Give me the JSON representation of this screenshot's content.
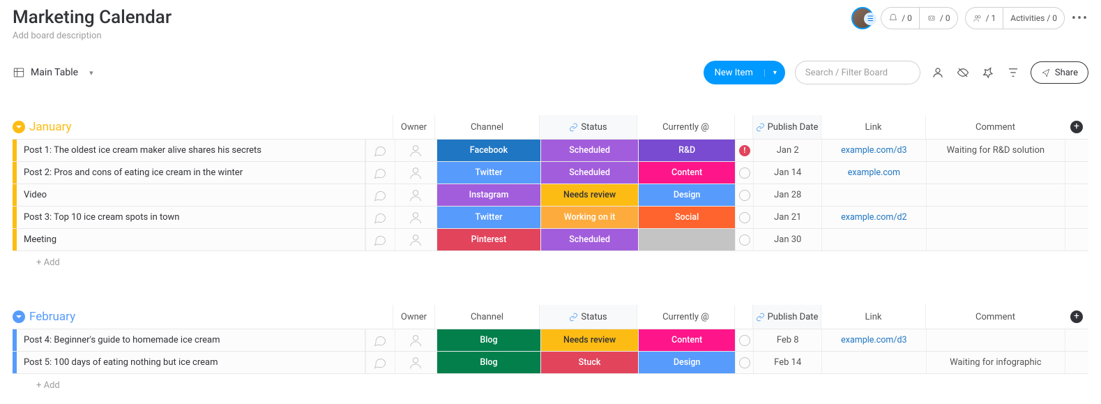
{
  "header": {
    "title": "Marketing Calendar",
    "description_placeholder": "Add board description",
    "counters": {
      "views": "/ 0",
      "integrations": "/ 0",
      "people": "/ 1",
      "activities": "Activities / 0"
    }
  },
  "toolbar": {
    "view_name": "Main Table",
    "new_item_label": "New Item",
    "search_placeholder": "Search / Filter Board",
    "share_label": "Share"
  },
  "columns": {
    "owner": "Owner",
    "channel": "Channel",
    "status": "Status",
    "currently": "Currently @",
    "publish": "Publish Date",
    "link": "Link",
    "comment": "Comment"
  },
  "colors": {
    "channel": {
      "Facebook": "#1f76c2",
      "Twitter": "#579bfc",
      "Instagram": "#a25ddc",
      "Pinterest": "#e2445c",
      "Blog": "#037f4c"
    },
    "status": {
      "Scheduled": "#a25ddc",
      "Needs review": "#fdbc13",
      "Working on it": "#fdab3d",
      "Stuck": "#e2445c"
    },
    "currently": {
      "R&D": "#784bd1",
      "Content": "#ff158a",
      "Design": "#579bfc",
      "Social": "#ff642e",
      "": "#c4c4c4"
    }
  },
  "groups": [
    {
      "name": "January",
      "color": "#fdbc13",
      "items": [
        {
          "name": "Post 1: The oldest ice cream maker alive shares his secrets",
          "channel": "Facebook",
          "status": "Scheduled",
          "currently": "R&D",
          "flag": "alert",
          "date": "Jan 2",
          "link": "example.com/d3",
          "comment": "Waiting for R&D solution"
        },
        {
          "name": "Post 2: Pros and cons of eating ice cream in the winter",
          "channel": "Twitter",
          "status": "Scheduled",
          "currently": "Content",
          "flag": "",
          "date": "Jan 14",
          "link": "example.com",
          "comment": ""
        },
        {
          "name": "Video",
          "channel": "Instagram",
          "status": "Needs review",
          "currently": "Design",
          "flag": "",
          "date": "Jan 28",
          "link": "",
          "comment": ""
        },
        {
          "name": "Post 3: Top 10 ice cream spots in town",
          "channel": "Twitter",
          "status": "Working on it",
          "currently": "Social",
          "flag": "",
          "date": "Jan 21",
          "link": "example.com/d2",
          "comment": ""
        },
        {
          "name": "Meeting",
          "channel": "Pinterest",
          "status": "Scheduled",
          "currently": "",
          "flag": "",
          "date": "Jan 30",
          "link": "",
          "comment": ""
        }
      ]
    },
    {
      "name": "February",
      "color": "#579bfc",
      "items": [
        {
          "name": "Post 4: Beginner's guide to homemade ice cream",
          "channel": "Blog",
          "status": "Needs review",
          "currently": "Content",
          "flag": "",
          "date": "Feb 8",
          "link": "example.com/d3",
          "comment": ""
        },
        {
          "name": "Post 5: 100 days of eating nothing but ice cream",
          "channel": "Blog",
          "status": "Stuck",
          "currently": "Design",
          "flag": "",
          "date": "Feb 14",
          "link": "",
          "comment": "Waiting for infographic"
        }
      ]
    }
  ],
  "misc": {
    "add_row": "+ Add"
  }
}
